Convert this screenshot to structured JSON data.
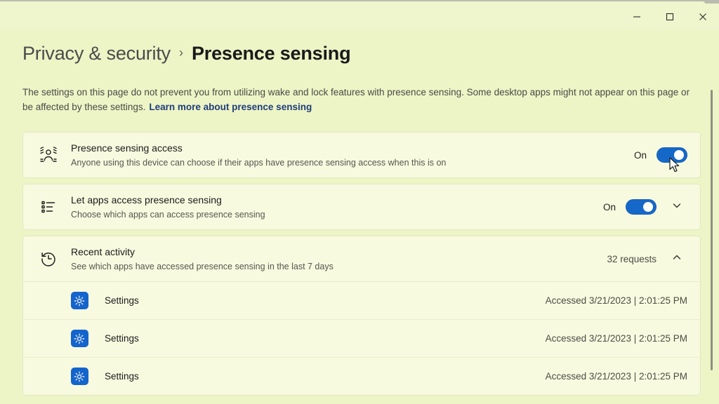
{
  "window": {
    "controls": [
      {
        "name": "minimize",
        "glyph": "minimize-icon",
        "tooltip": "Minimize"
      },
      {
        "name": "maximize",
        "glyph": "maximize-icon",
        "tooltip": "Maximize"
      },
      {
        "name": "close",
        "glyph": "close-icon",
        "tooltip": "Close"
      }
    ]
  },
  "header": {
    "breadcrumb_parent": "Privacy & security",
    "breadcrumb_separator": "›",
    "page_title": "Presence sensing",
    "description_text": "The settings on this page do not prevent you from utilizing wake and lock features with presence sensing. Some desktop apps might not appear on this page or be affected by these settings.",
    "description_link": "Learn more about presence sensing"
  },
  "settings": {
    "presence_access": {
      "icon": "presence-sensing-icon",
      "title": "Presence sensing access",
      "subtitle": "Anyone using this device can choose if their apps have presence sensing access when this is on",
      "state_label": "On",
      "toggle_on": true
    },
    "app_access": {
      "icon": "list-icon",
      "title": "Let apps access presence sensing",
      "subtitle": "Choose which apps can access presence sensing",
      "state_label": "On",
      "toggle_on": true,
      "expand_icon": "chevron-down-icon",
      "expanded": false
    },
    "recent_activity": {
      "icon": "history-icon",
      "title": "Recent activity",
      "subtitle": "See which apps have accessed presence sensing in the last 7 days",
      "count_label": "32 requests",
      "collapse_icon": "chevron-up-icon",
      "expanded": true,
      "entries": [
        {
          "icon": "settings-app-icon",
          "name": "Settings",
          "accessed": "Accessed 3/21/2023  |  2:01:25 PM"
        },
        {
          "icon": "settings-app-icon",
          "name": "Settings",
          "accessed": "Accessed 3/21/2023  |  2:01:25 PM"
        },
        {
          "icon": "settings-app-icon",
          "name": "Settings",
          "accessed": "Accessed 3/21/2023  |  2:01:25 PM"
        }
      ]
    }
  },
  "colors": {
    "page_background": "#edf4c6",
    "card_background": "#f8fadf",
    "toggle_accent": "#1668c8",
    "link": "#1f3d7a",
    "app_icon": "#1464cd",
    "scrollbar_thumb": "#8e907f"
  }
}
